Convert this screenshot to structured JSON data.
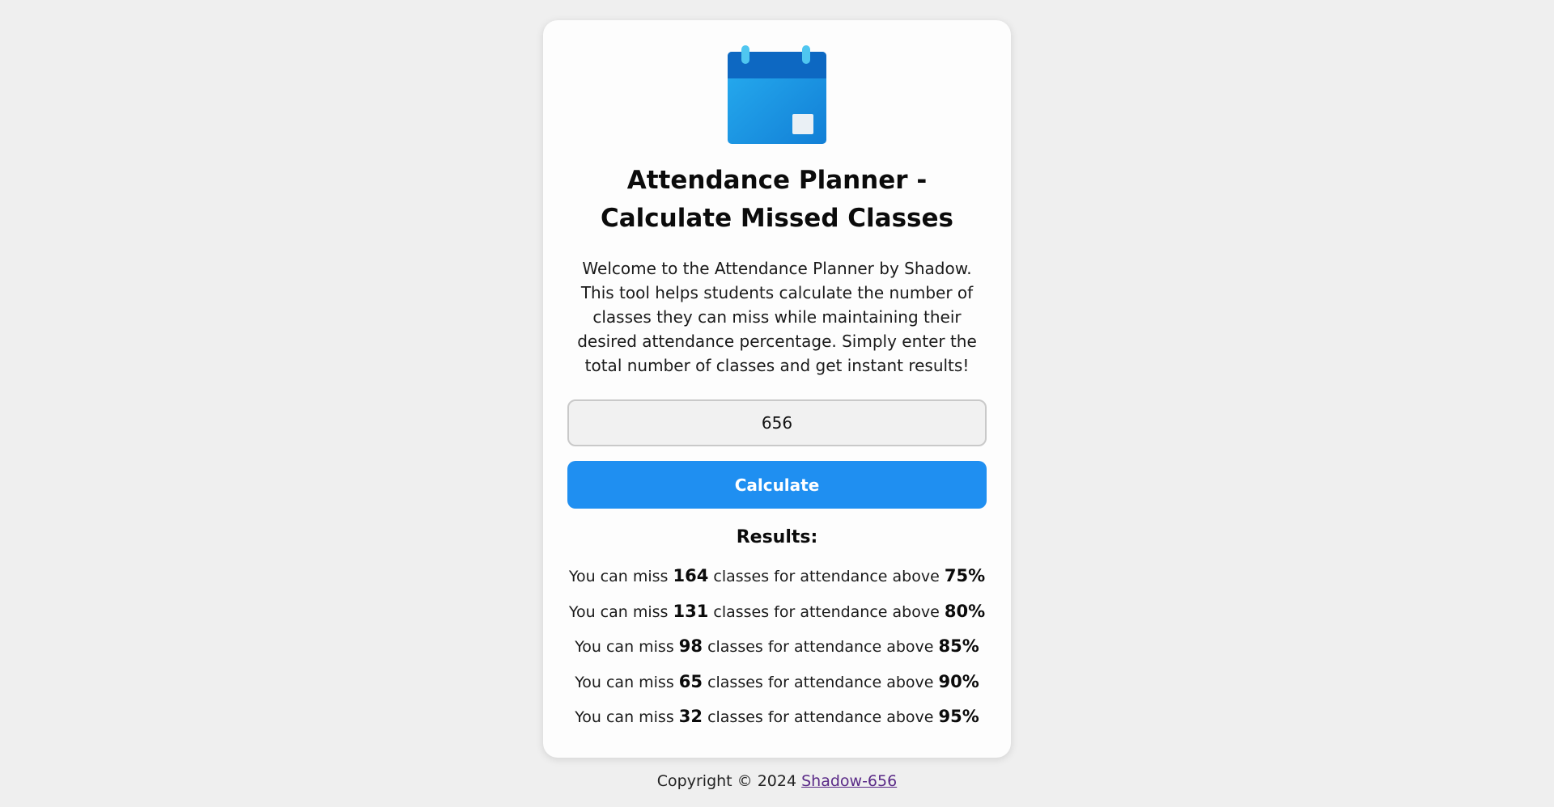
{
  "header": {
    "title": "Attendance Planner - Calculate Missed Classes",
    "description": "Welcome to the Attendance Planner by Shadow. This tool helps students calculate the number of classes they can miss while maintaining their desired attendance percentage. Simply enter the total number of classes and get instant results!",
    "logo_icon": "calendar-icon"
  },
  "form": {
    "total_classes_value": "656",
    "calculate_label": "Calculate"
  },
  "results": {
    "title": "Results:",
    "prefix": "You can miss",
    "middle": "classes for attendance above",
    "rows": [
      {
        "count": "164",
        "percent": "75%"
      },
      {
        "count": "131",
        "percent": "80%"
      },
      {
        "count": "98",
        "percent": "85%"
      },
      {
        "count": "65",
        "percent": "90%"
      },
      {
        "count": "32",
        "percent": "95%"
      }
    ]
  },
  "footer": {
    "copyright": "Copyright © 2024",
    "author_link": "Shadow-656"
  },
  "colors": {
    "background": "#efefef",
    "card": "#fdfdfd",
    "button": "#1f8ff1",
    "calendar_top": "#0c6fc9",
    "calendar_body": "#1e9ee8",
    "link": "#5a2a87"
  }
}
